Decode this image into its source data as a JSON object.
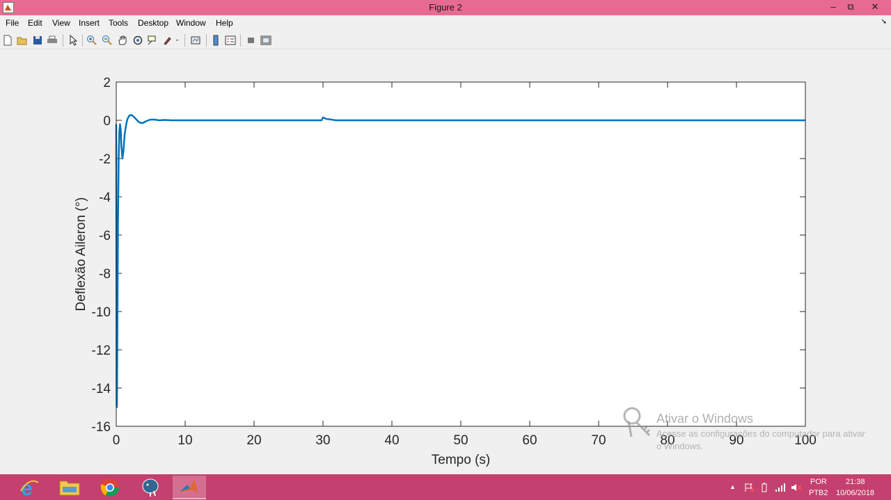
{
  "window": {
    "title": "Figure 2",
    "controls": [
      "–",
      "⧉",
      "✕"
    ]
  },
  "menu": {
    "items": [
      "File",
      "Edit",
      "View",
      "Insert",
      "Tools",
      "Desktop",
      "Window",
      "Help"
    ]
  },
  "toolbar": {
    "tools": [
      "new-figure",
      "open-file",
      "save",
      "print",
      "edit-plot",
      "zoom-in",
      "zoom-out",
      "pan",
      "rotate-3d",
      "data-cursor",
      "brush",
      "link-plot",
      "insert-colorbar",
      "insert-legend",
      "hide-plot-tools",
      "show-plot-tools"
    ]
  },
  "chart_data": {
    "type": "line",
    "title": "",
    "xlabel": "Tempo (s)",
    "ylabel": "Deflexão Aileron (°)",
    "xlim": [
      0,
      100
    ],
    "ylim": [
      -16,
      2
    ],
    "xticks": [
      0,
      10,
      20,
      30,
      40,
      50,
      60,
      70,
      80,
      90,
      100
    ],
    "yticks": [
      2,
      0,
      -2,
      -4,
      -6,
      -8,
      -10,
      -12,
      -14,
      -16
    ],
    "grid": false,
    "line_color": "#0072bd",
    "series": [
      {
        "x": [
          0,
          0.05,
          0.1,
          0.15,
          0.25,
          0.35,
          0.45,
          0.55,
          0.65,
          0.75,
          0.9,
          1.05,
          1.2,
          1.4,
          1.6,
          1.9,
          2.2,
          2.5,
          2.9,
          3.3,
          3.8,
          4.3,
          4.9,
          5.5,
          6.2,
          7,
          8,
          10,
          15,
          20,
          25,
          29.8,
          30,
          30.2,
          30.5,
          31,
          31.5,
          32,
          33,
          40,
          50,
          60,
          70,
          80,
          90,
          100
        ],
        "y": [
          -0.2,
          -14.9,
          -15,
          -12,
          -5.5,
          -2,
          -0.6,
          -0.2,
          -0.5,
          -1.4,
          -2,
          -1.6,
          -0.8,
          -0.3,
          0.05,
          0.25,
          0.28,
          0.2,
          0.05,
          -0.1,
          -0.15,
          -0.05,
          0.03,
          0.04,
          0,
          0.02,
          0,
          0,
          0,
          0,
          0,
          0,
          0.15,
          0.12,
          0.07,
          0.05,
          0.02,
          0,
          0,
          0,
          0,
          0,
          0,
          0,
          0,
          0
        ]
      }
    ]
  },
  "watermark": {
    "title": "Ativar o Windows",
    "subtitle": "Acesse as configurações do computador para ativar o Windows."
  },
  "taskbar": {
    "apps": [
      "internet-explorer",
      "file-explorer",
      "chrome",
      "postgresql",
      "matlab"
    ],
    "lang_1": "POR",
    "lang_2": "PTB2",
    "time": "21:38",
    "date": "10/06/2018"
  }
}
